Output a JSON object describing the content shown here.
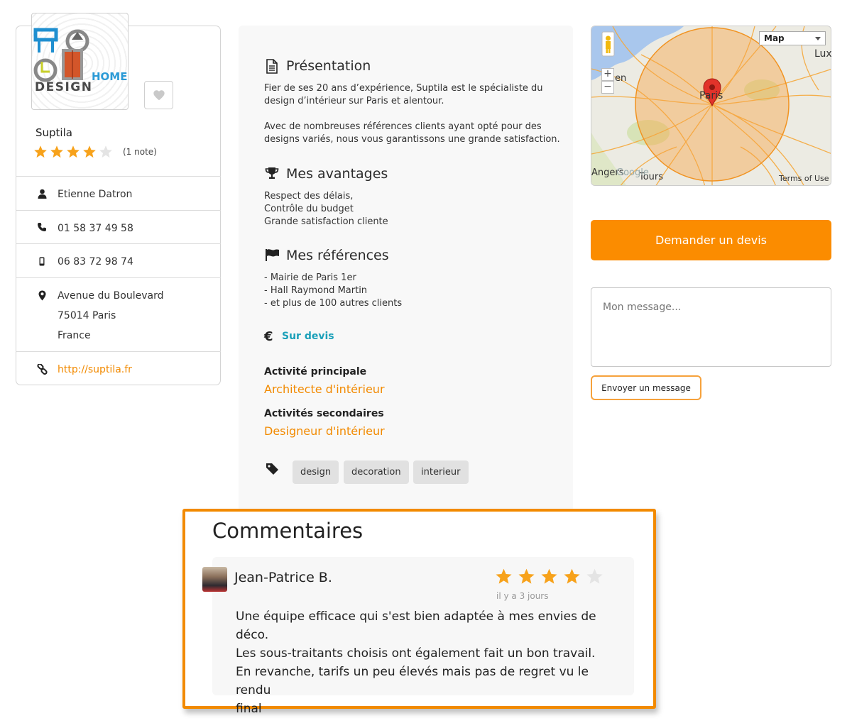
{
  "colors": {
    "accent": "#fb8c00",
    "link_teal": "#1ba0b9",
    "star_on": "#f7a21b",
    "star_off": "#e4e4e4"
  },
  "provider": {
    "logo": {
      "line1": "HOME",
      "line2": "DESIGN"
    },
    "name": "Suptila",
    "rating": 4,
    "rating_max": 5,
    "note_count": "(1 note)",
    "contact": "Etienne Datron",
    "phone": "01 58 37 49 58",
    "mobile": "06 83 72 98 74",
    "address": {
      "line1": "Avenue du Boulevard",
      "line2": "75014 Paris",
      "line3": "France"
    },
    "website": "http://suptila.fr"
  },
  "presentation": {
    "title": "Présentation",
    "text": "Fier de ses 20 ans d’expérience, Suptila est le spécialiste du\ndesign d’intérieur sur Paris et alentour.\n\nAvec de nombreuses références clients ayant opté pour des\ndesigns variés, nous vous garantissons une grande satisfaction."
  },
  "advantages": {
    "title": "Mes avantages",
    "text": "Respect des délais,\nContrôle du budget\nGrande satisfaction cliente"
  },
  "references": {
    "title": "Mes références",
    "text": "- Mairie de Paris 1er\n- Hall Raymond Martin\n- et plus de 100 autres clients"
  },
  "price": {
    "symbol": "€",
    "label": "Sur devis"
  },
  "activities": {
    "main_label": "Activité principale",
    "main_value": "Architecte d'intérieur",
    "secondary_label": "Activités secondaires",
    "secondary_value": "Designeur d'intérieur"
  },
  "tags": [
    "design",
    "decoration",
    "interieur"
  ],
  "map": {
    "type_select": "Map",
    "city_main": "Paris",
    "city_tours": "Tours",
    "city_angers": "Angers",
    "city_caen": "en",
    "city_lux": "Lux",
    "terms": "Terms of Use",
    "google": "Google",
    "zoom_in": "+",
    "zoom_out": "−"
  },
  "quote_button": "Demander un devis",
  "message": {
    "placeholder": "Mon message...",
    "send_button": "Envoyer un message"
  },
  "comments": {
    "title": "Commentaires",
    "items": [
      {
        "author": "Jean-Patrice B.",
        "rating": 4,
        "ago": "il y a 3 jours",
        "text": "Une équipe efficace qui s'est bien adaptée à mes envies de déco.\nLes sous-traitants choisis ont également fait un bon travail.\nEn revanche, tarifs un peu élevés mais pas de regret vu le rendu\nfinal"
      }
    ]
  }
}
